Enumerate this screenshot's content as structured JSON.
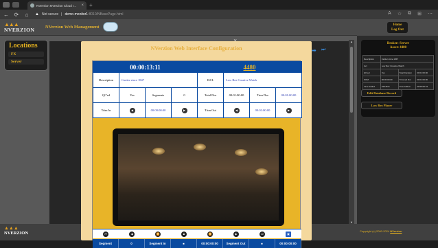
{
  "browser": {
    "tab_title": "NVersion NVerzion Cloud I...",
    "tab_close": "×",
    "new_tab": "+",
    "nav_back": "←",
    "nav_forward": "→",
    "nav_refresh": "⟳",
    "nav_home": "⌂",
    "warning_icon": "▲",
    "security_label": "Not secure",
    "separator": "|",
    "url_host": "demo-monitor1",
    "url_path": ":8010/NBasePage.html",
    "toolbar_icons": [
      "A",
      "☆",
      "⧉",
      "⊞",
      "⋯"
    ]
  },
  "header": {
    "logo_text": "NVERZION",
    "logo_mountains": "▲▲▲",
    "app_name": "NVerzion Web Management"
  },
  "sidebar": {
    "title": "Locations",
    "items": [
      {
        "label": "FX"
      },
      {
        "label": "Server"
      }
    ]
  },
  "modal": {
    "title": "NVerzion Web Interface Configuration",
    "close": "×",
    "next_icon": "➡",
    "end_icon": "⏭",
    "timer": "00:00:13:11",
    "isci_value": "4480",
    "description_label": "Description",
    "description_value": "Cartier since 1847",
    "isci_label": "ISCI:",
    "isci_title": "Low Rez Creative Watch",
    "qc_label": "QC'ed",
    "qc_value": "Yes",
    "segments_label": "Segments",
    "segments_value": "0",
    "total_dur_label": "Total Dur",
    "total_dur_value": "00:01:00:00",
    "trim_dur_label": "Trim Dur",
    "trim_dur_value": "00:01:00:00",
    "trim_in_label": "Trim In",
    "trim_in_value": "00:00:00:00",
    "trim_out_label": "Trim Out",
    "trim_out_value": "00:01:00:00",
    "seg_row": [
      "Segment",
      "0",
      "Segment In",
      "⏹",
      "00:00:00:00",
      "Segment Out",
      "⏹",
      "00:00:00:00"
    ]
  },
  "right_panel": {
    "home_label": "Home",
    "logout_label": "Log Out",
    "broker_title": "Broker: Server",
    "asset_title": "Asset: 4480",
    "info_rows": [
      [
        "Description",
        "Cartier since 1847",
        "",
        ""
      ],
      [
        "Isci",
        "Low Rez Creative Watch",
        "",
        ""
      ],
      [
        "QC'ed",
        "Yes",
        "Total Duration",
        "00:01:00:00"
      ],
      [
        "SOM",
        "00:00:00:00",
        "Trimmed Dur",
        "00:01:00:00"
      ],
      [
        "Time Added",
        "04/18/19",
        "Time Added",
        "00:55:06:19"
      ]
    ],
    "edit_button": "Edit Database Record",
    "player_button": "Low Rez Player",
    "copyright_prefix": "Copyright (c) 2000-2024",
    "copyright_link": "NVerzion"
  },
  "footer": {
    "logo_text": "NVERZION",
    "logo_mountains": "▲▲▲"
  },
  "colors": {
    "accent_gold": "#e3b020",
    "table_blue": "#0a4aa0",
    "modal_bg": "#f4d89d"
  }
}
